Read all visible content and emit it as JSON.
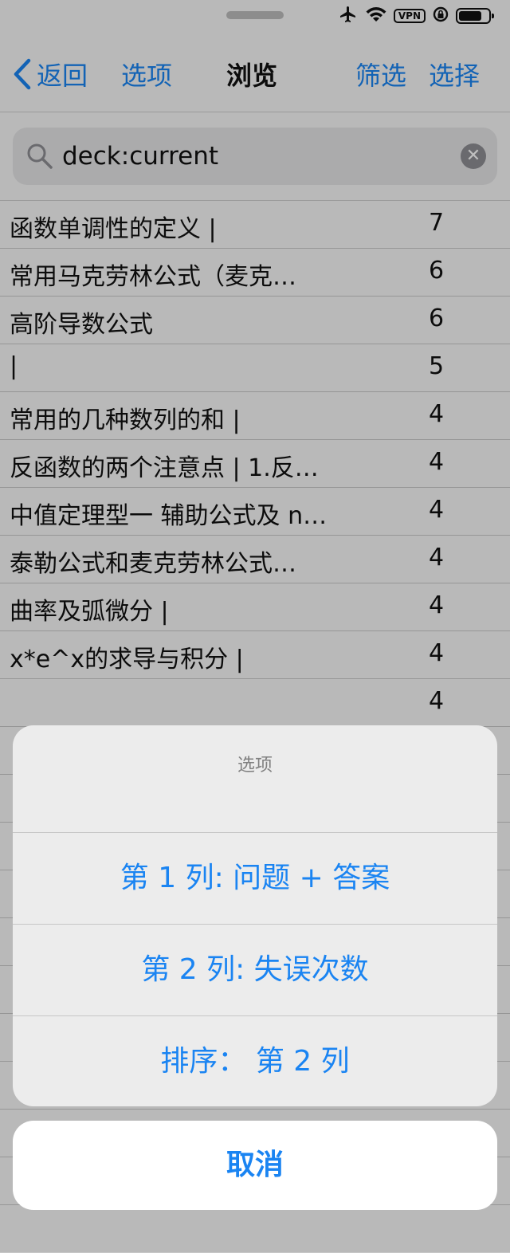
{
  "status": {
    "vpn_label": "VPN",
    "icons": [
      "airplane-icon",
      "wifi-icon",
      "vpn-badge",
      "rotation-lock-icon",
      "battery-icon"
    ]
  },
  "nav": {
    "back_label": "返回",
    "options_label": "选项",
    "title": "浏览",
    "filter_label": "筛选",
    "select_label": "选择"
  },
  "search": {
    "value": "deck:current",
    "clear_glyph": "✕"
  },
  "rows": [
    {
      "question": "函数单调性的定义 |",
      "count": "7"
    },
    {
      "question": "常用马克劳林公式（麦克…",
      "count": "6"
    },
    {
      "question": "高阶导数公式",
      "count": "6"
    },
    {
      "question": "|",
      "count": "5"
    },
    {
      "question": "常用的几种数列的和 |",
      "count": "4"
    },
    {
      "question": "反函数的两个注意点 | 1.反…",
      "count": "4"
    },
    {
      "question": "中值定理型一 辅助公式及 n…",
      "count": "4"
    },
    {
      "question": "泰勒公式和麦克劳林公式…",
      "count": "4"
    },
    {
      "question": "曲率及弧微分 |",
      "count": "4"
    },
    {
      "question": "x*e^x的求导与积分 |",
      "count": "4"
    },
    {
      "question": "",
      "count": "4"
    }
  ],
  "sheet": {
    "title": "选项",
    "buttons": [
      "第 1 列: 问题 + 答案",
      "第 2 列: 失误次数",
      "排序：  第 2 列"
    ],
    "cancel_label": "取消"
  },
  "colors": {
    "accent": "#1a84f2",
    "sheet_bg": "#ececec",
    "overlay": "rgba(0,0,0,0.25)"
  }
}
